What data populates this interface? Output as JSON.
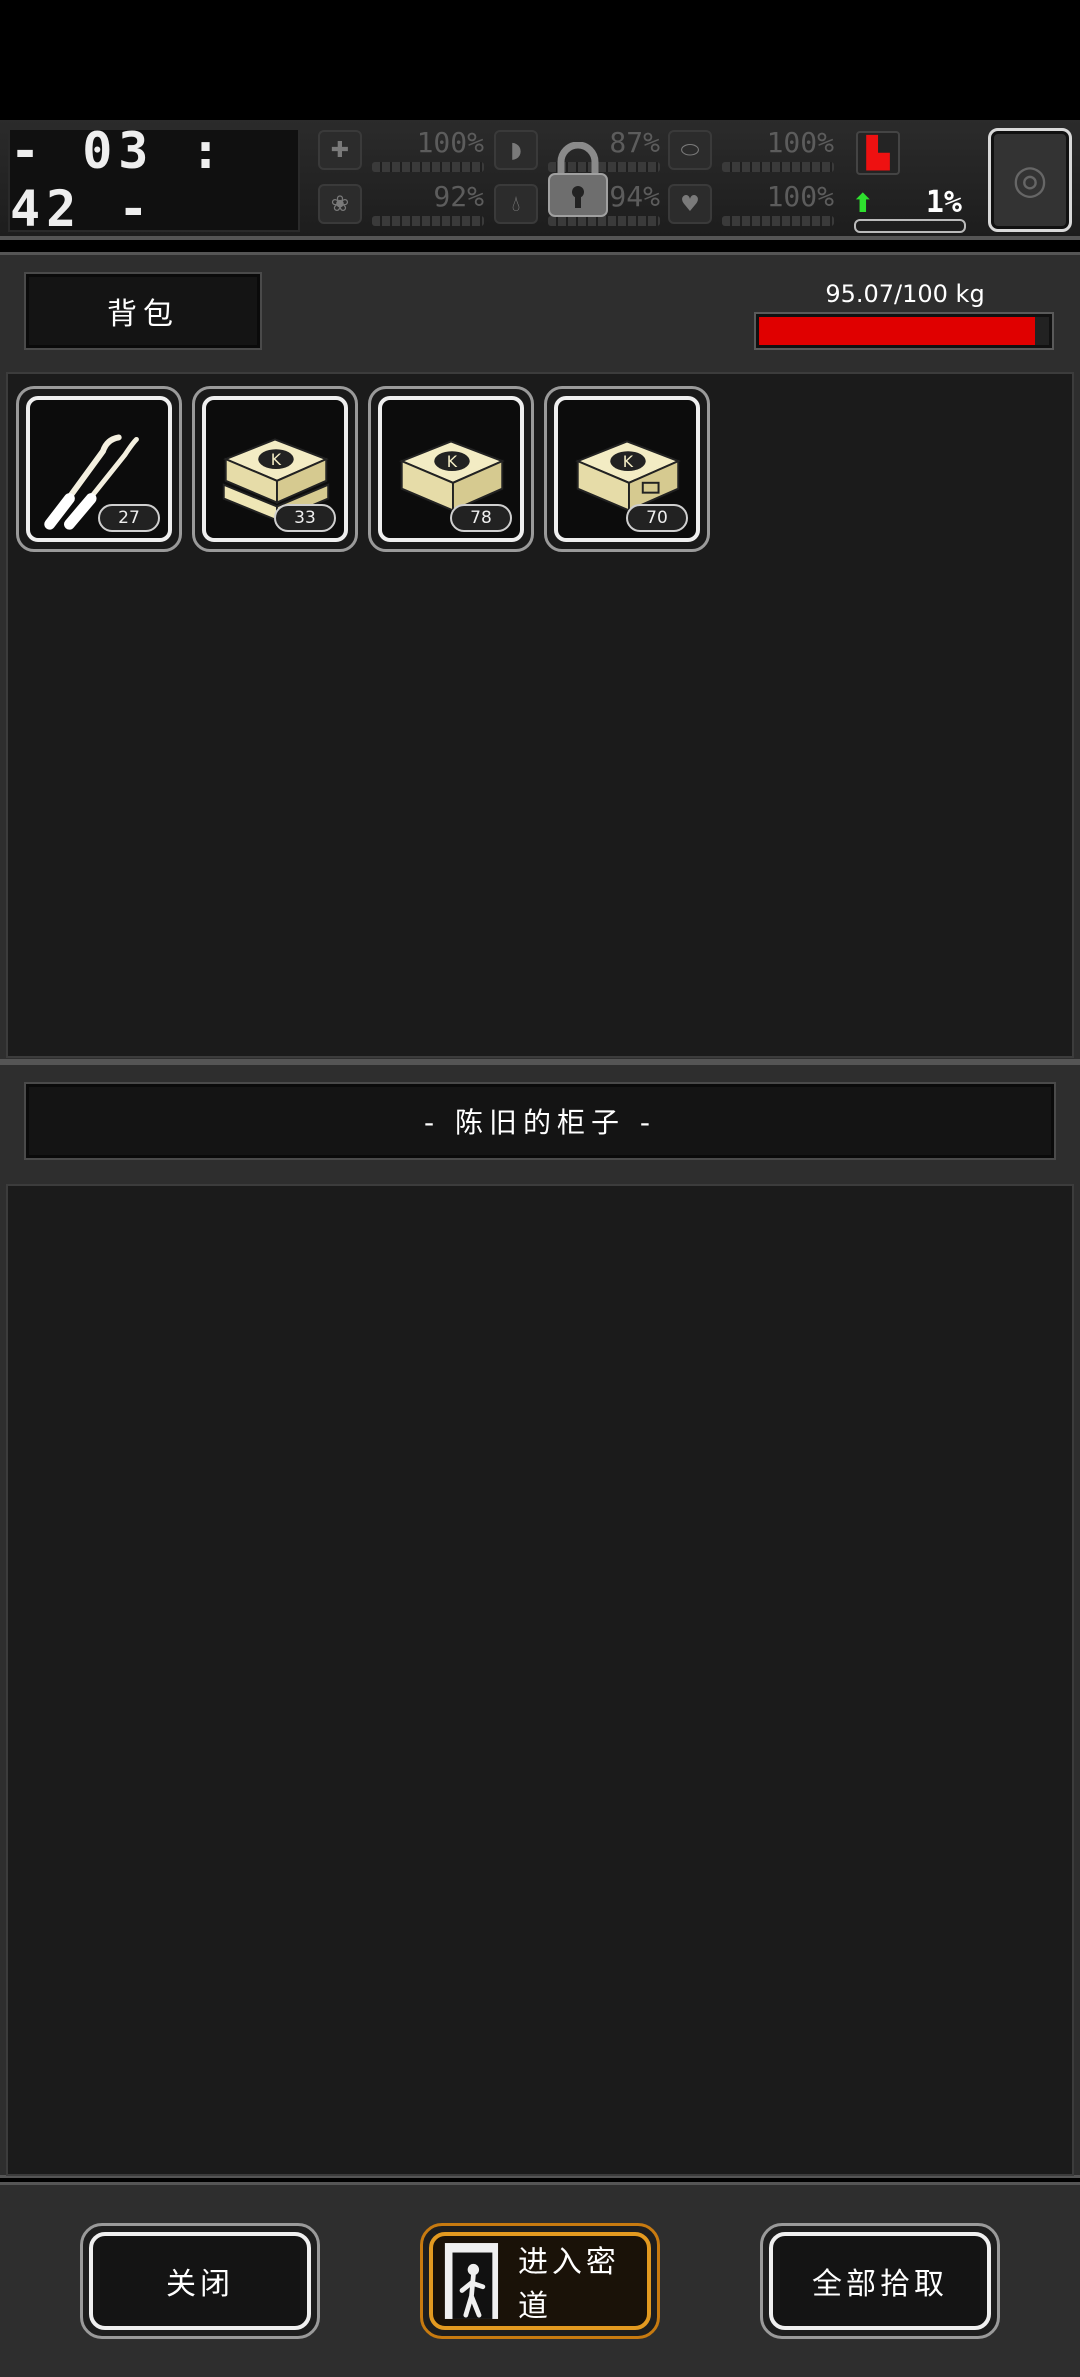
{
  "hud": {
    "clock": "- 03 : 42 -",
    "stats": [
      {
        "name": "health",
        "value": "100%"
      },
      {
        "name": "hunger",
        "value": "87%"
      },
      {
        "name": "armor",
        "value": "100%"
      },
      {
        "name": "sanity",
        "value": "92%"
      },
      {
        "name": "thirst",
        "value": "94%"
      },
      {
        "name": "heart",
        "value": "100%"
      }
    ],
    "player_percent": "1%"
  },
  "backpack": {
    "title": "背包",
    "weight": "95.07/100 kg",
    "weight_fraction": 0.95,
    "items": [
      {
        "icon": "lockpick-icon",
        "count": "27"
      },
      {
        "icon": "cardbox-stack-icon",
        "count": "33"
      },
      {
        "icon": "cardbox-icon",
        "count": "78"
      },
      {
        "icon": "cardbox-icon",
        "count": "70"
      }
    ]
  },
  "container": {
    "title": "- 陈旧的柜子 -"
  },
  "actions": {
    "close": "关闭",
    "enter_passage": "进入密道",
    "take_all": "全部拾取"
  },
  "colors": {
    "accent_orange": "#e39a20",
    "weight_red": "#e00000",
    "arrow_green": "#2ee02e"
  }
}
